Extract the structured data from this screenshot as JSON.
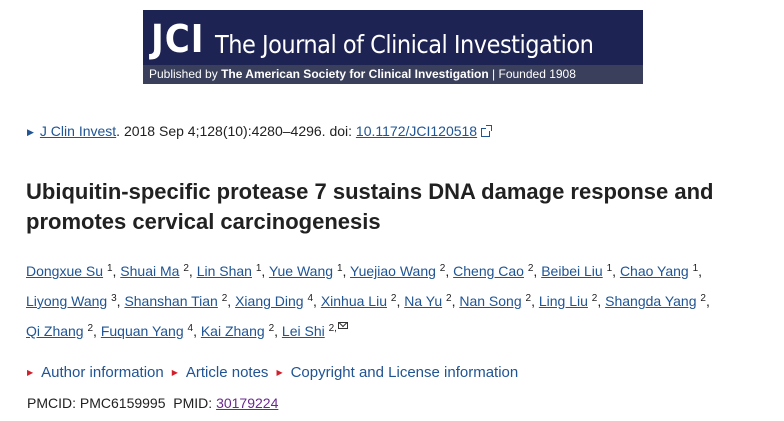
{
  "banner": {
    "logo": "JCI",
    "journal_name": "The Journal of Clinical Investigation",
    "published_by": "Published by",
    "society": "The American Society for Clinical Investigation",
    "separator": "|",
    "founded": "Founded 1908"
  },
  "citation": {
    "journal_link": "J Clin Invest",
    "details": ". 2018 Sep 4;128(10):4280–4296. doi: ",
    "doi": "10.1172/JCI120518",
    "icons": [
      "triangle-right-icon",
      "external-link-icon"
    ]
  },
  "title": "Ubiquitin-specific protease 7 sustains DNA damage response and promotes cervical carcinogenesis",
  "authors": [
    {
      "name": "Dongxue Su",
      "aff": "1"
    },
    {
      "name": "Shuai Ma",
      "aff": "2"
    },
    {
      "name": "Lin Shan",
      "aff": "1"
    },
    {
      "name": "Yue Wang",
      "aff": "1"
    },
    {
      "name": "Yuejiao Wang",
      "aff": "2"
    },
    {
      "name": "Cheng Cao",
      "aff": "2"
    },
    {
      "name": "Beibei Liu",
      "aff": "1"
    },
    {
      "name": "Chao Yang",
      "aff": "1"
    },
    {
      "name": "Liyong Wang",
      "aff": "3"
    },
    {
      "name": "Shanshan Tian",
      "aff": "2"
    },
    {
      "name": "Xiang Ding",
      "aff": "4"
    },
    {
      "name": "Xinhua Liu",
      "aff": "2"
    },
    {
      "name": "Na Yu",
      "aff": "2"
    },
    {
      "name": "Nan Song",
      "aff": "2"
    },
    {
      "name": "Ling Liu",
      "aff": "2"
    },
    {
      "name": "Shangda Yang",
      "aff": "2"
    },
    {
      "name": "Qi Zhang",
      "aff": "2"
    },
    {
      "name": "Fuquan Yang",
      "aff": "4"
    },
    {
      "name": "Kai Zhang",
      "aff": "2"
    },
    {
      "name": "Lei Shi",
      "aff": "2,",
      "corresponding": true
    }
  ],
  "links": [
    {
      "label": "Author information"
    },
    {
      "label": "Article notes"
    },
    {
      "label": "Copyright and License information"
    }
  ],
  "ids": {
    "pmcid_label": "PMCID: ",
    "pmcid": "PMC6159995",
    "pmid_label": "PMID: ",
    "pmid": "30179224"
  },
  "colors": {
    "banner_bg": "#1d2352",
    "banner_strip": "#3a3f5c",
    "link": "#205493",
    "visited_link": "#6a2a8c",
    "bullet_red": "#d21f2b"
  }
}
